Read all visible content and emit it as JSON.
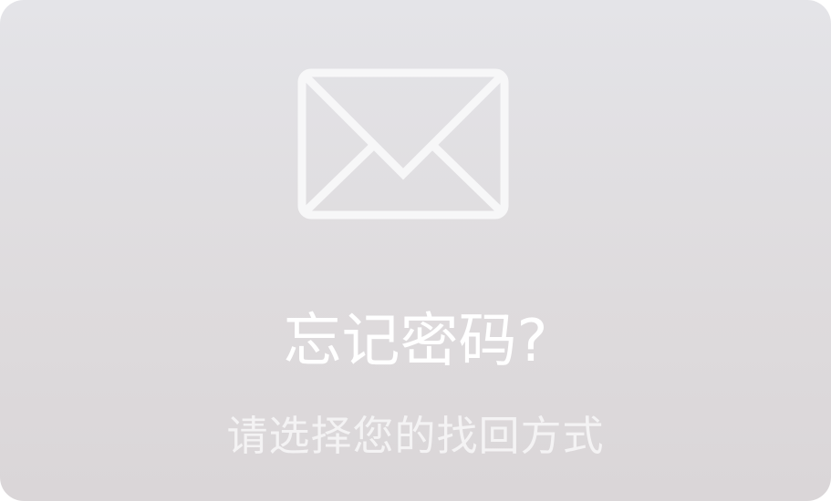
{
  "dialog": {
    "icon": "envelope-icon",
    "title": "忘记密码?",
    "subtitle": "请选择您的找回方式"
  },
  "colors": {
    "background_top": "#e4e4e8",
    "background_bottom": "#dad6d8",
    "foreground": "#ffffff"
  }
}
